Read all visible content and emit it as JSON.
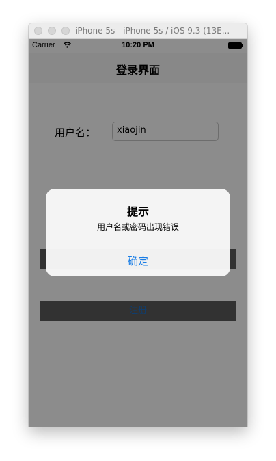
{
  "window": {
    "title": "iPhone 5s - iPhone 5s / iOS 9.3 (13E..."
  },
  "status_bar": {
    "carrier": "Carrier",
    "time": "10:20 PM"
  },
  "nav": {
    "title": "登录界面"
  },
  "form": {
    "username_label": "用户名：",
    "username_value": "xiaojin",
    "register_label": "注册"
  },
  "alert": {
    "title": "提示",
    "message": "用户名或密码出现错误",
    "ok_label": "确定"
  },
  "colors": {
    "accent": "#1a7ee6",
    "button_bg": "#5b5b5b"
  }
}
